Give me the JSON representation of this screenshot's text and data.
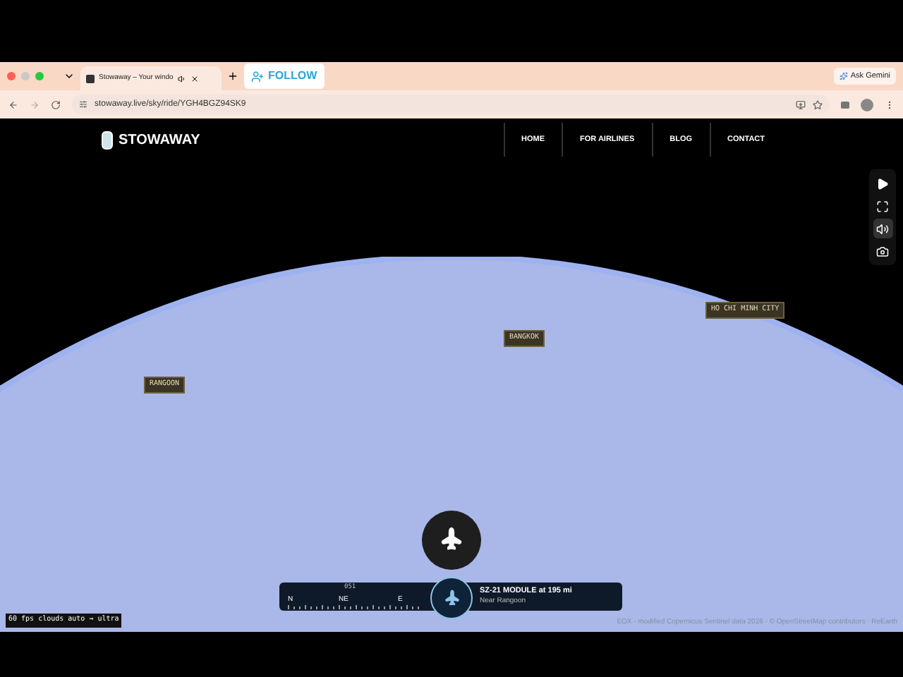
{
  "browser": {
    "tab": {
      "title": "Stowaway – Your windo",
      "selected": true
    },
    "follow_button": "FOLLOW",
    "gemini_button": "Ask Gemini",
    "url": "stowaway.live/sky/ride/YGH4BGZ94SK9"
  },
  "site": {
    "logo": "STOWAWAY",
    "nav": [
      {
        "label": "HOME"
      },
      {
        "label": "FOR AIRLINES"
      },
      {
        "label": "BLOG"
      },
      {
        "label": "CONTACT"
      }
    ]
  },
  "controls": [
    {
      "kind": "play",
      "selected": false
    },
    {
      "kind": "fullscreen",
      "selected": false
    },
    {
      "kind": "sound",
      "selected": true
    },
    {
      "kind": "camera",
      "selected": false
    }
  ],
  "map_labels": [
    "HO CHI MINH CITY",
    "BANGKOK",
    "RANGOON"
  ],
  "compass": {
    "heading": "051",
    "marks": [
      "N",
      "NE",
      "E"
    ]
  },
  "flight": {
    "title": "SZ-21 MODULE at 195 mi",
    "subtitle": "Near Rangoon"
  },
  "stats": "60 fps clouds auto → ultra",
  "attribution": "EOX - modified Copernicus Sentinel data 2026 · © OpenStreetMap contributors · ReEarth"
}
